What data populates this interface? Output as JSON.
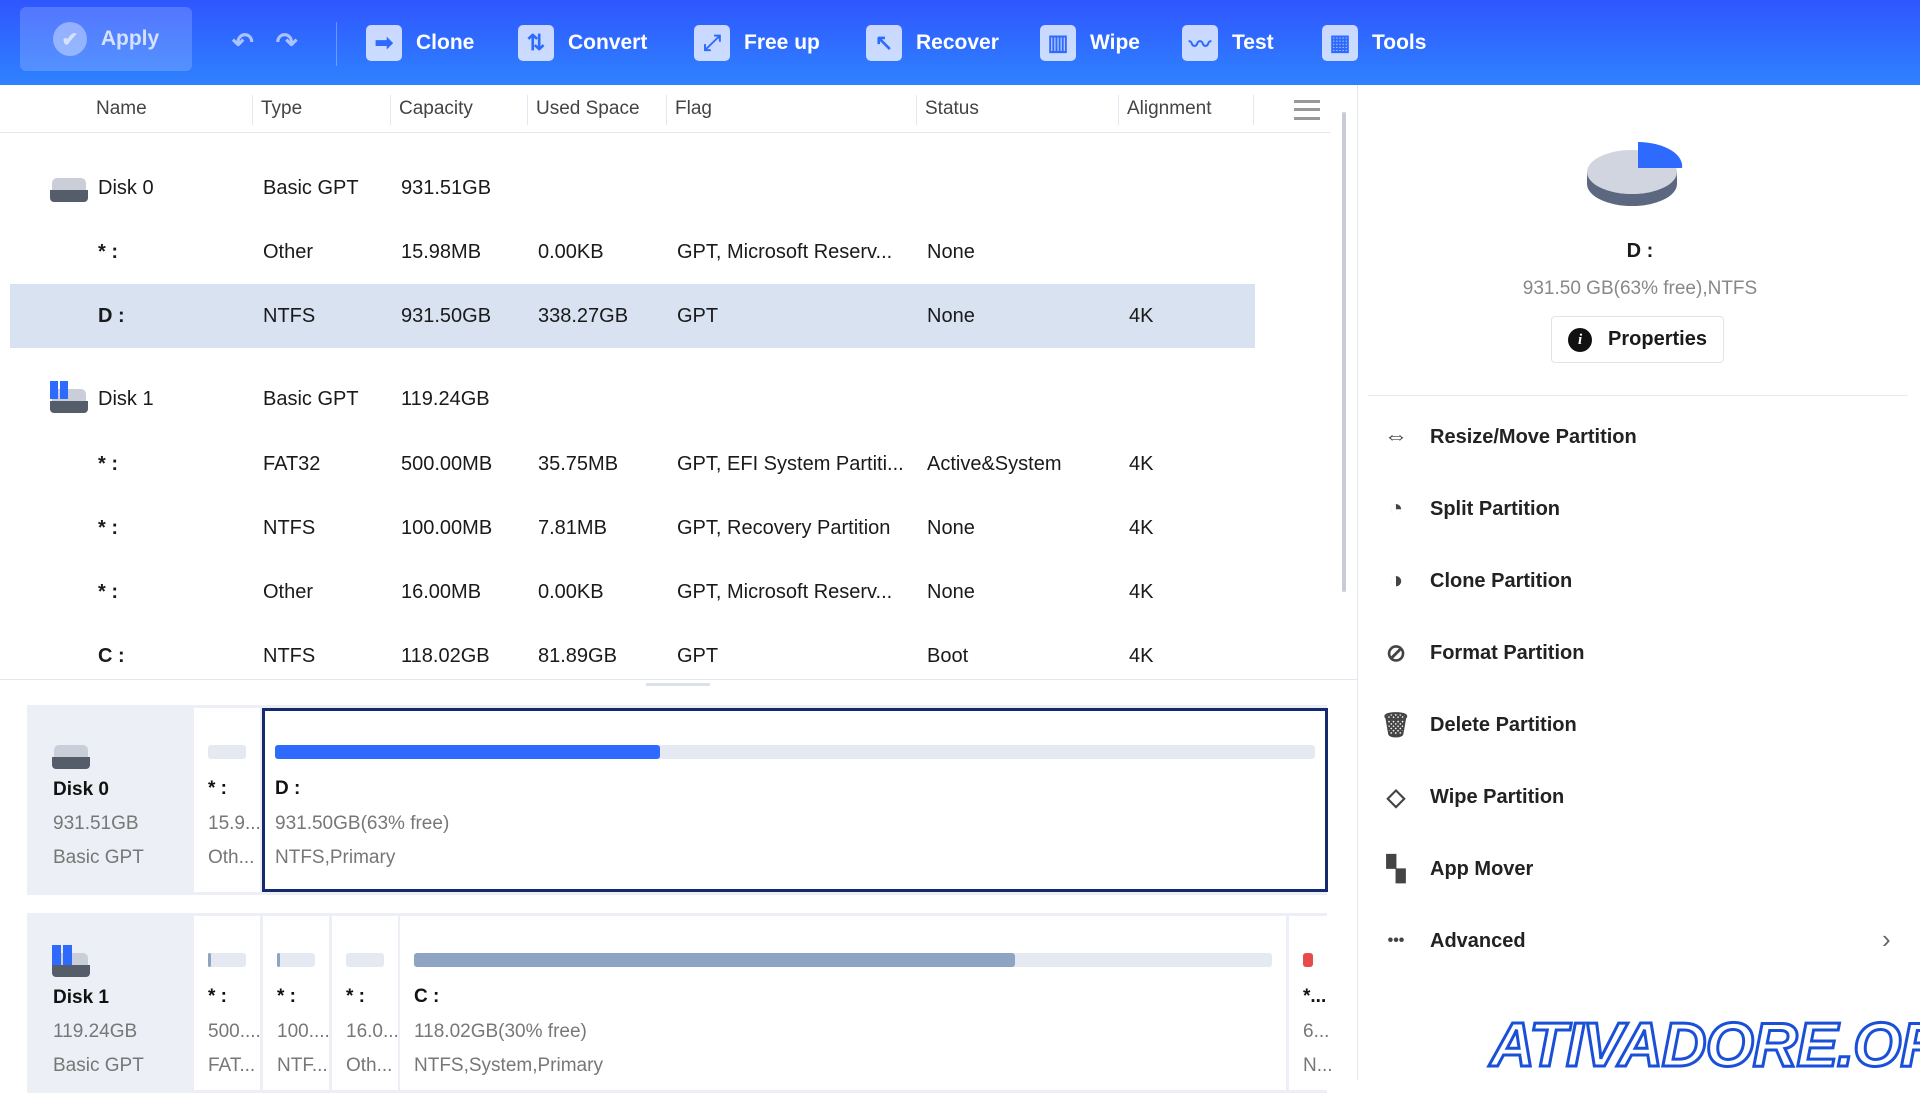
{
  "toolbar": {
    "apply": "Apply",
    "items": [
      {
        "label": "Clone",
        "icon": "clone-icon"
      },
      {
        "label": "Convert",
        "icon": "convert-icon"
      },
      {
        "label": "Free up",
        "icon": "free-up-icon"
      },
      {
        "label": "Recover",
        "icon": "recover-icon"
      },
      {
        "label": "Wipe",
        "icon": "wipe-icon"
      },
      {
        "label": "Test",
        "icon": "test-icon"
      },
      {
        "label": "Tools",
        "icon": "tools-icon"
      }
    ]
  },
  "table": {
    "columns": [
      "Name",
      "Type",
      "Capacity",
      "Used Space",
      "Flag",
      "Status",
      "Alignment"
    ],
    "rows": [
      {
        "kind": "disk",
        "name": "Disk 0",
        "type": "Basic GPT",
        "capacity": "931.51GB",
        "used": "",
        "flag": "",
        "status": "",
        "align": ""
      },
      {
        "kind": "part",
        "name": "* :",
        "type": "Other",
        "capacity": "15.98MB",
        "used": "0.00KB",
        "flag": "GPT, Microsoft Reserv...",
        "status": "None",
        "align": ""
      },
      {
        "kind": "part",
        "name": "D :",
        "type": "NTFS",
        "capacity": "931.50GB",
        "used": "338.27GB",
        "flag": "GPT",
        "status": "None",
        "align": "4K",
        "selected": true
      },
      {
        "kind": "disk",
        "name": "Disk 1",
        "type": "Basic GPT",
        "capacity": "119.24GB",
        "used": "",
        "flag": "",
        "status": "",
        "align": ""
      },
      {
        "kind": "part",
        "name": "* :",
        "type": "FAT32",
        "capacity": "500.00MB",
        "used": "35.75MB",
        "flag": "GPT, EFI System Partiti...",
        "status": "Active&System",
        "align": "4K"
      },
      {
        "kind": "part",
        "name": "* :",
        "type": "NTFS",
        "capacity": "100.00MB",
        "used": "7.81MB",
        "flag": "GPT, Recovery Partition",
        "status": "None",
        "align": "4K"
      },
      {
        "kind": "part",
        "name": "* :",
        "type": "Other",
        "capacity": "16.00MB",
        "used": "0.00KB",
        "flag": "GPT, Microsoft Reserv...",
        "status": "None",
        "align": "4K"
      },
      {
        "kind": "part",
        "name": "C :",
        "type": "NTFS",
        "capacity": "118.02GB",
        "used": "81.89GB",
        "flag": "GPT",
        "status": "Boot",
        "align": "4K"
      }
    ]
  },
  "diskmap": {
    "disk0": {
      "name": "Disk 0",
      "size": "931.51GB",
      "type": "Basic GPT",
      "parts": [
        {
          "name": "* :",
          "size": "15.9...",
          "fs": "Oth...",
          "used_pct": 0
        },
        {
          "name": "D :",
          "size": "931.50GB(63% free)",
          "fs": "NTFS,Primary",
          "used_pct": 37,
          "selected": true
        }
      ]
    },
    "disk1": {
      "name": "Disk 1",
      "size": "119.24GB",
      "type": "Basic GPT",
      "parts": [
        {
          "name": "* :",
          "size": "500....",
          "fs": "FAT...",
          "used_pct": 7
        },
        {
          "name": "* :",
          "size": "100....",
          "fs": "NTF...",
          "used_pct": 8
        },
        {
          "name": "* :",
          "size": "16.0...",
          "fs": "Oth...",
          "used_pct": 0
        },
        {
          "name": "C :",
          "size": "118.02GB(30% free)",
          "fs": "NTFS,System,Primary",
          "used_pct": 70
        },
        {
          "name": "*...",
          "size": "6...",
          "fs": "N...",
          "used_pct": 100
        }
      ]
    }
  },
  "panel": {
    "drive": "D :",
    "info": "931.50 GB(63% free),NTFS",
    "used_pct": 37,
    "properties": "Properties",
    "actions": [
      {
        "label": "Resize/Move Partition",
        "icon": "resize-icon"
      },
      {
        "label": "Split Partition",
        "icon": "split-icon"
      },
      {
        "label": "Clone Partition",
        "icon": "clone-partition-icon"
      },
      {
        "label": "Format Partition",
        "icon": "format-icon"
      },
      {
        "label": "Delete Partition",
        "icon": "trash-icon"
      },
      {
        "label": "Wipe Partition",
        "icon": "eraser-icon"
      },
      {
        "label": "App Mover",
        "icon": "app-mover-icon"
      },
      {
        "label": "Advanced",
        "icon": "more-icon"
      }
    ]
  },
  "watermark": "ATIVADORE.ORG",
  "colors": {
    "accent": "#2f6aff",
    "selected_row": "#d8e2f0",
    "used_bar": "#2f6aff",
    "system_bar": "#8fa3c2"
  }
}
